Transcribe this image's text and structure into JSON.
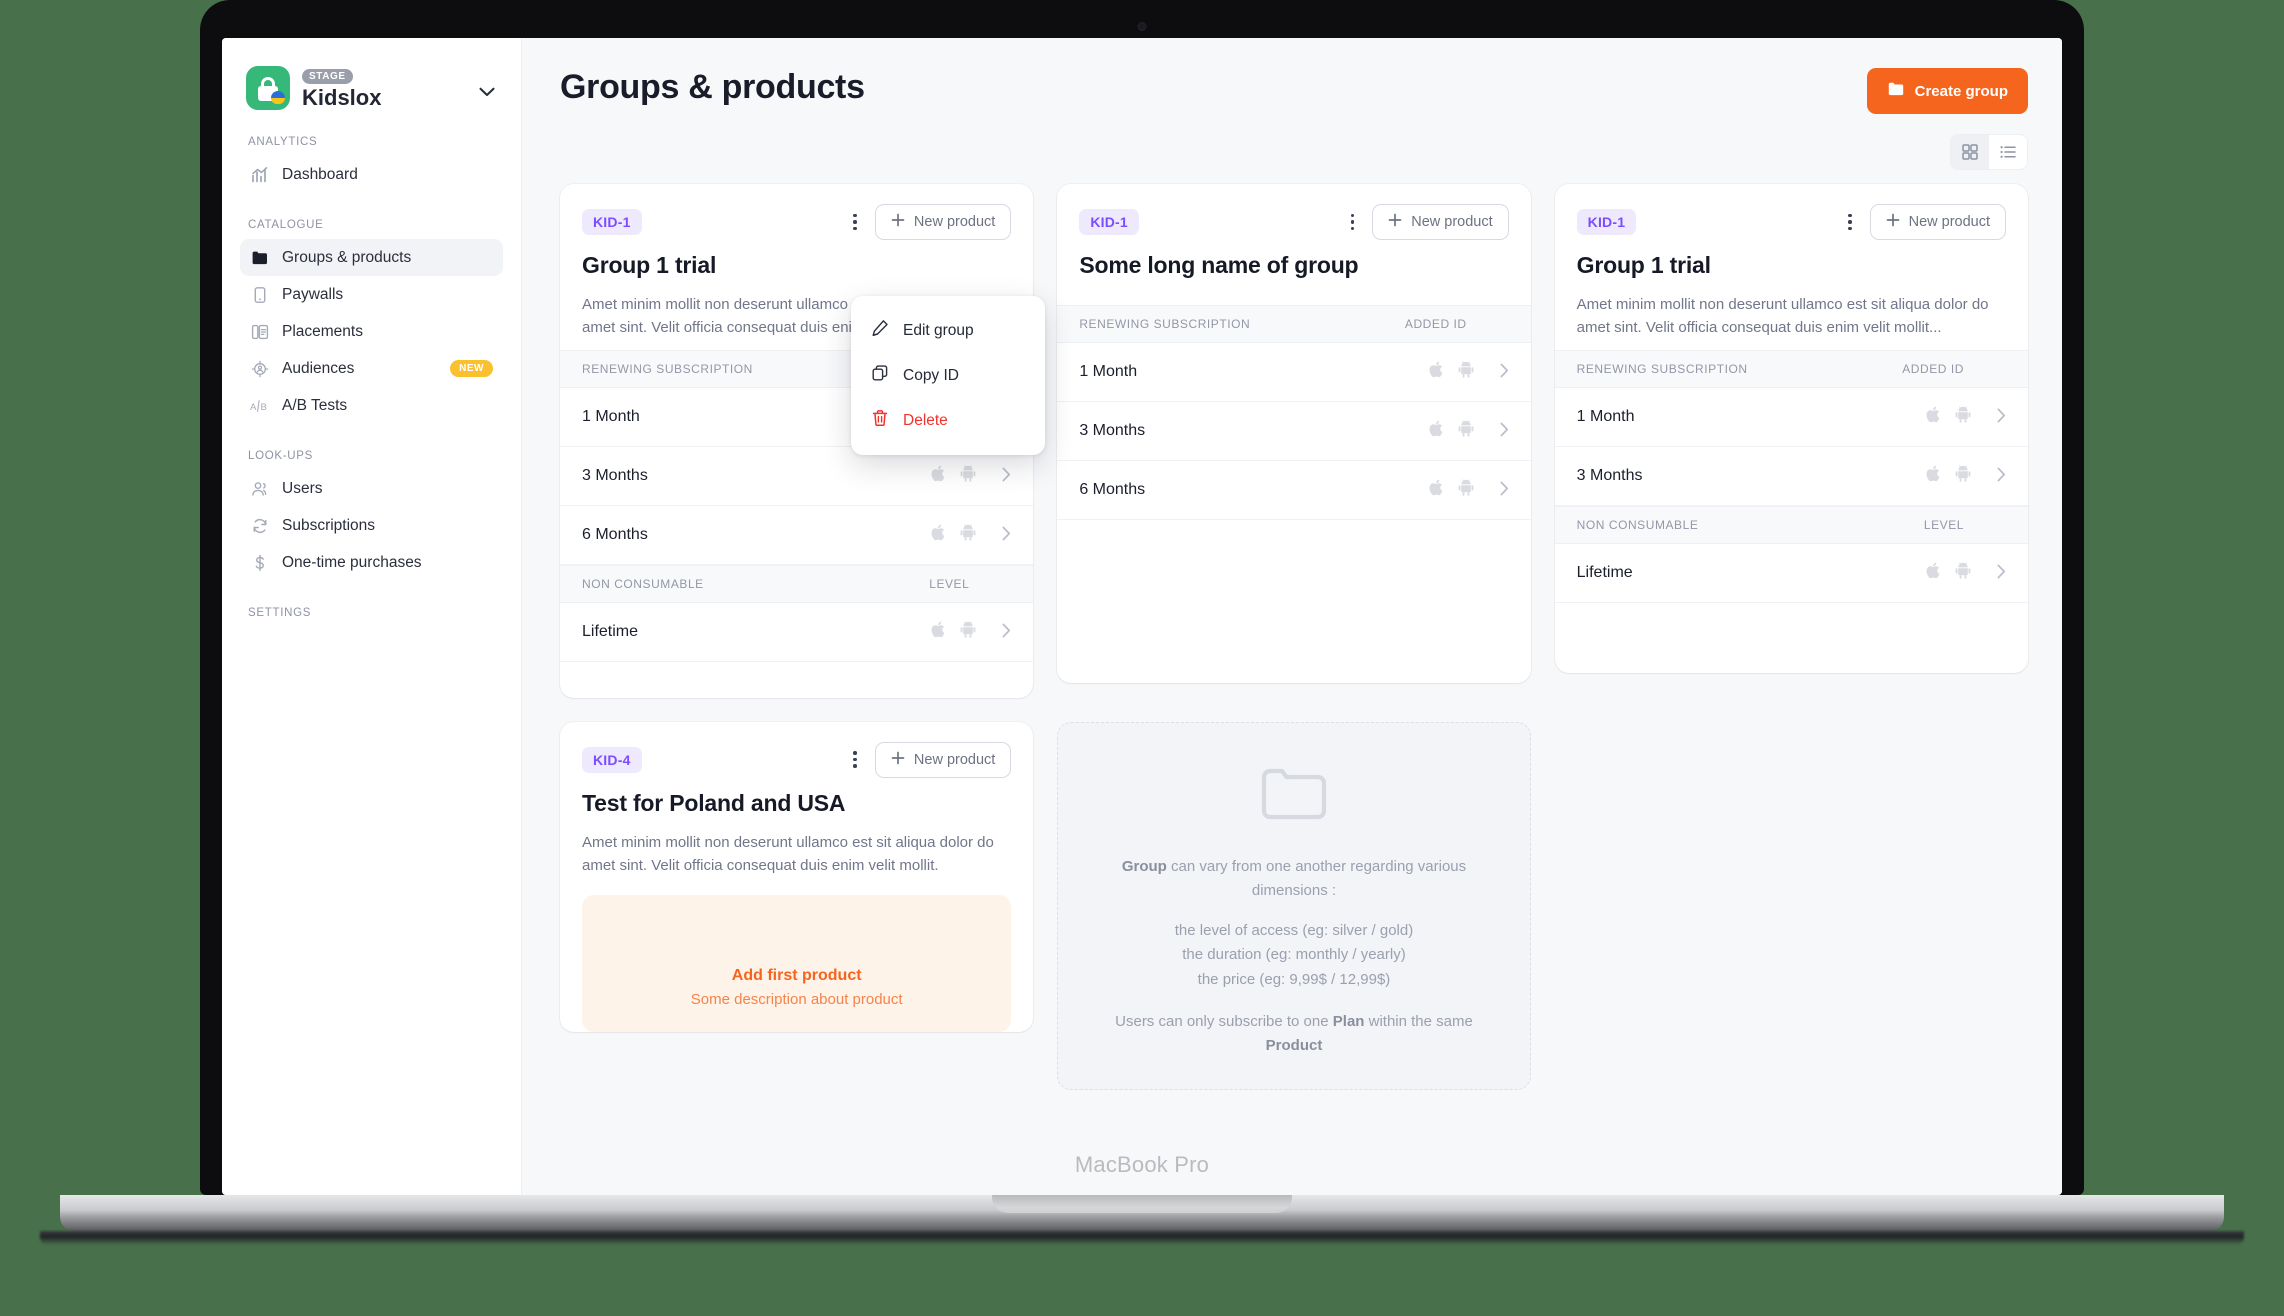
{
  "device": {
    "label": "MacBook Pro"
  },
  "brand": {
    "stage_badge": "STAGE",
    "name": "Kidslox"
  },
  "sidebar": {
    "sections": [
      {
        "title": "ANALYTICS",
        "items": [
          {
            "label": "Dashboard",
            "icon": "chart-icon",
            "active": false
          }
        ]
      },
      {
        "title": "CATALOGUE",
        "items": [
          {
            "label": "Groups & products",
            "icon": "folder-icon",
            "active": true
          },
          {
            "label": "Paywalls",
            "icon": "phone-icon",
            "active": false
          },
          {
            "label": "Placements",
            "icon": "placements-icon",
            "active": false
          },
          {
            "label": "Audiences",
            "icon": "target-icon",
            "active": false,
            "badge": "NEW"
          },
          {
            "label": "A/B Tests",
            "icon": "ab-icon",
            "active": false
          }
        ]
      },
      {
        "title": "LOOK-UPS",
        "items": [
          {
            "label": "Users",
            "icon": "users-icon",
            "active": false
          },
          {
            "label": "Subscriptions",
            "icon": "refresh-icon",
            "active": false
          },
          {
            "label": "One-time purchases",
            "icon": "dollar-icon",
            "active": false
          }
        ]
      },
      {
        "title": "SETTINGS",
        "items": []
      }
    ]
  },
  "header": {
    "title": "Groups & products",
    "create_button": "Create group",
    "create_button_icon": "folder-plus-icon",
    "view_toggle": {
      "grid": "grid-view-icon",
      "list": "list-view-icon",
      "selected": "grid"
    }
  },
  "group_menu": {
    "items": [
      {
        "label": "Edit group",
        "icon": "pencil-icon",
        "danger": false
      },
      {
        "label": "Copy ID",
        "icon": "copy-icon",
        "danger": false
      },
      {
        "label": "Delete",
        "icon": "trash-icon",
        "danger": true
      }
    ]
  },
  "cards": [
    {
      "badge": "KID-1",
      "title": "Group 1 trial",
      "description": "Amet minim mollit non deserunt ullamco est sit aliqua dolor do amet sint. Velit officia consequat duis enim velit mollit.",
      "new_product_label": "New product",
      "tables": [
        {
          "col1": "RENEWING SUBSCRIPTION",
          "col2": "ADDED ID",
          "rows": [
            {
              "name": "1 Month"
            },
            {
              "name": "3 Months"
            },
            {
              "name": "6 Months"
            }
          ]
        },
        {
          "col1": "NON CONSUMABLE",
          "col2": "LEVEL",
          "rows": [
            {
              "name": "Lifetime"
            }
          ]
        }
      ]
    },
    {
      "badge": "KID-1",
      "title": "Some long name of group",
      "description": "",
      "new_product_label": "New product",
      "tables": [
        {
          "col1": "RENEWING SUBSCRIPTION",
          "col2": "ADDED ID",
          "rows": [
            {
              "name": "1 Month"
            },
            {
              "name": "3 Months"
            },
            {
              "name": "6 Months"
            }
          ]
        }
      ]
    },
    {
      "badge": "KID-1",
      "title": "Group 1 trial",
      "description": "Amet minim mollit non deserunt ullamco est sit aliqua dolor do amet sint. Velit officia consequat duis enim velit mollit...",
      "new_product_label": "New product",
      "tables": [
        {
          "col1": "RENEWING SUBSCRIPTION",
          "col2": "ADDED ID",
          "rows": [
            {
              "name": "1 Month"
            },
            {
              "name": "3 Months"
            }
          ]
        },
        {
          "col1": "NON CONSUMABLE",
          "col2": "LEVEL",
          "rows": [
            {
              "name": "Lifetime"
            }
          ]
        }
      ]
    },
    {
      "badge": "KID-4",
      "title": "Test for Poland and USA",
      "description": "Amet minim mollit non deserunt ullamco est sit aliqua dolor do amet sint. Velit officia consequat duis enim velit mollit.",
      "new_product_label": "New product",
      "tables": [],
      "add_first": {
        "title": "Add first product",
        "subtitle": "Some description about product"
      }
    }
  ],
  "empty_card": {
    "icon": "folder-icon",
    "line1_bold": "Group",
    "line1_rest": " can vary from one another regarding various dimensions :",
    "bullets": [
      "the level of access (eg: silver / gold)",
      "the duration (eg: monthly / yearly)",
      "the price (eg: 9,99$ / 12,99$)"
    ],
    "tail_pre": "Users can only subscribe to one ",
    "tail_b1": "Plan",
    "tail_mid": " within the same ",
    "tail_b2": "Product"
  },
  "colors": {
    "accent": "#f5651e",
    "badge_purple_bg": "#eee9fd",
    "badge_purple_fg": "#7c4dff",
    "brand_green": "#35b878",
    "new_badge": "#fbc02d",
    "danger": "#f4322c",
    "page_bg": "#f7f8fa",
    "desktop_bg": "#48704b"
  }
}
